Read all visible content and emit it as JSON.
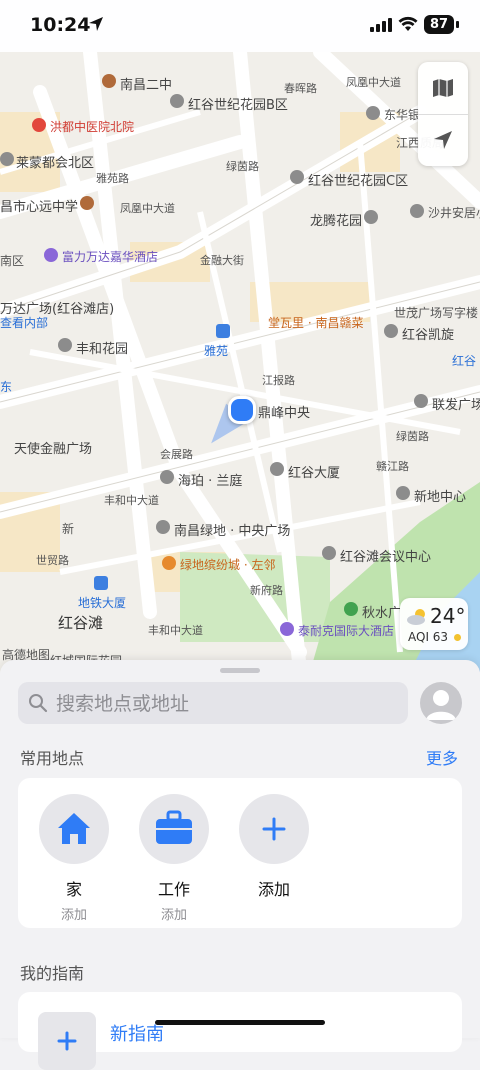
{
  "status": {
    "time": "10:24",
    "battery": "87"
  },
  "map": {
    "labels": {
      "nanchang_erzhong": "南昌二中",
      "honggu_century_b": "红谷世纪花园Β区",
      "fenghuang_middle": "凤凰中大道",
      "hongdu_hospital": "洪都中医院北院",
      "dongyin": "东华银",
      "chunhui_rd": "春晖路",
      "jiangxi_quality": "江西质局",
      "laimeng": "莱蒙都会北区",
      "lvyin_rd": "绿茵路",
      "honggu_century_c": "红谷世纪花园C区",
      "xinyuan_school": "昌市心远中学",
      "yawan_rd": "雅苑路",
      "fenghuang_middle2": "凤凰中大道",
      "longteng": "龙腾花园",
      "shaojing": "沙井安居小",
      "nanqu": "南区",
      "wanda_hotel": "富力万达嘉华酒店",
      "jinrong_st": "金融大街",
      "wanda_plaza": "万达广场(红谷滩店)",
      "view_inside": "查看内部",
      "tangwali": "堂瓦里 · 南昌赣菜",
      "shimao": "世茂广场写字楼",
      "fenghe": "丰和花园",
      "yayuan_station": "雅苑",
      "hongguk": "红谷凯旋",
      "honggu_edge": "红谷",
      "jiangbang_rd": "江报路",
      "dongfeng": "东",
      "dingfeng": "鼎峰中央",
      "lianfa": "联发广场",
      "tianshi": "天使金融广场",
      "huizhan_rd": "会展路",
      "lvying_rd2": "绿茵路",
      "haipo": "海珀 · 兰庭",
      "honggu_tower": "红谷大厦",
      "ganzhou_rd": "赣江路",
      "xindi": "新地中心",
      "fenghe_middle": "丰和中大道",
      "nanchang_greenland": "南昌绿地 · 中央广场",
      "huiyi_center": "红谷滩会议中心",
      "shimao_rd": "世贸路",
      "xin_rd": "新",
      "lvdi_binfen": "绿地缤纷城 · 左邻",
      "xinfu_rd": "新府路",
      "qiushui": "秋水广",
      "metro_dasha": "地铁大厦",
      "fenghe_middle2": "丰和中大道",
      "hongguitan": "红谷滩",
      "taiyike": "泰耐克国际大酒店",
      "gaode": "高德地图",
      "hongcheng": "红城国际花园"
    },
    "weather": {
      "temp": "24°",
      "aqi": "AQI 63"
    }
  },
  "search": {
    "placeholder": "搜索地点或地址"
  },
  "favorites": {
    "title": "常用地点",
    "more": "更多",
    "items": [
      {
        "name": "家",
        "sub": "添加"
      },
      {
        "name": "工作",
        "sub": "添加"
      },
      {
        "name": "添加",
        "sub": ""
      }
    ]
  },
  "guides": {
    "title": "我的指南",
    "new_label": "新指南"
  },
  "colors": {
    "accent": "#2f7cf6",
    "park": "#cfe9c1",
    "water": "#a9d3f2"
  }
}
